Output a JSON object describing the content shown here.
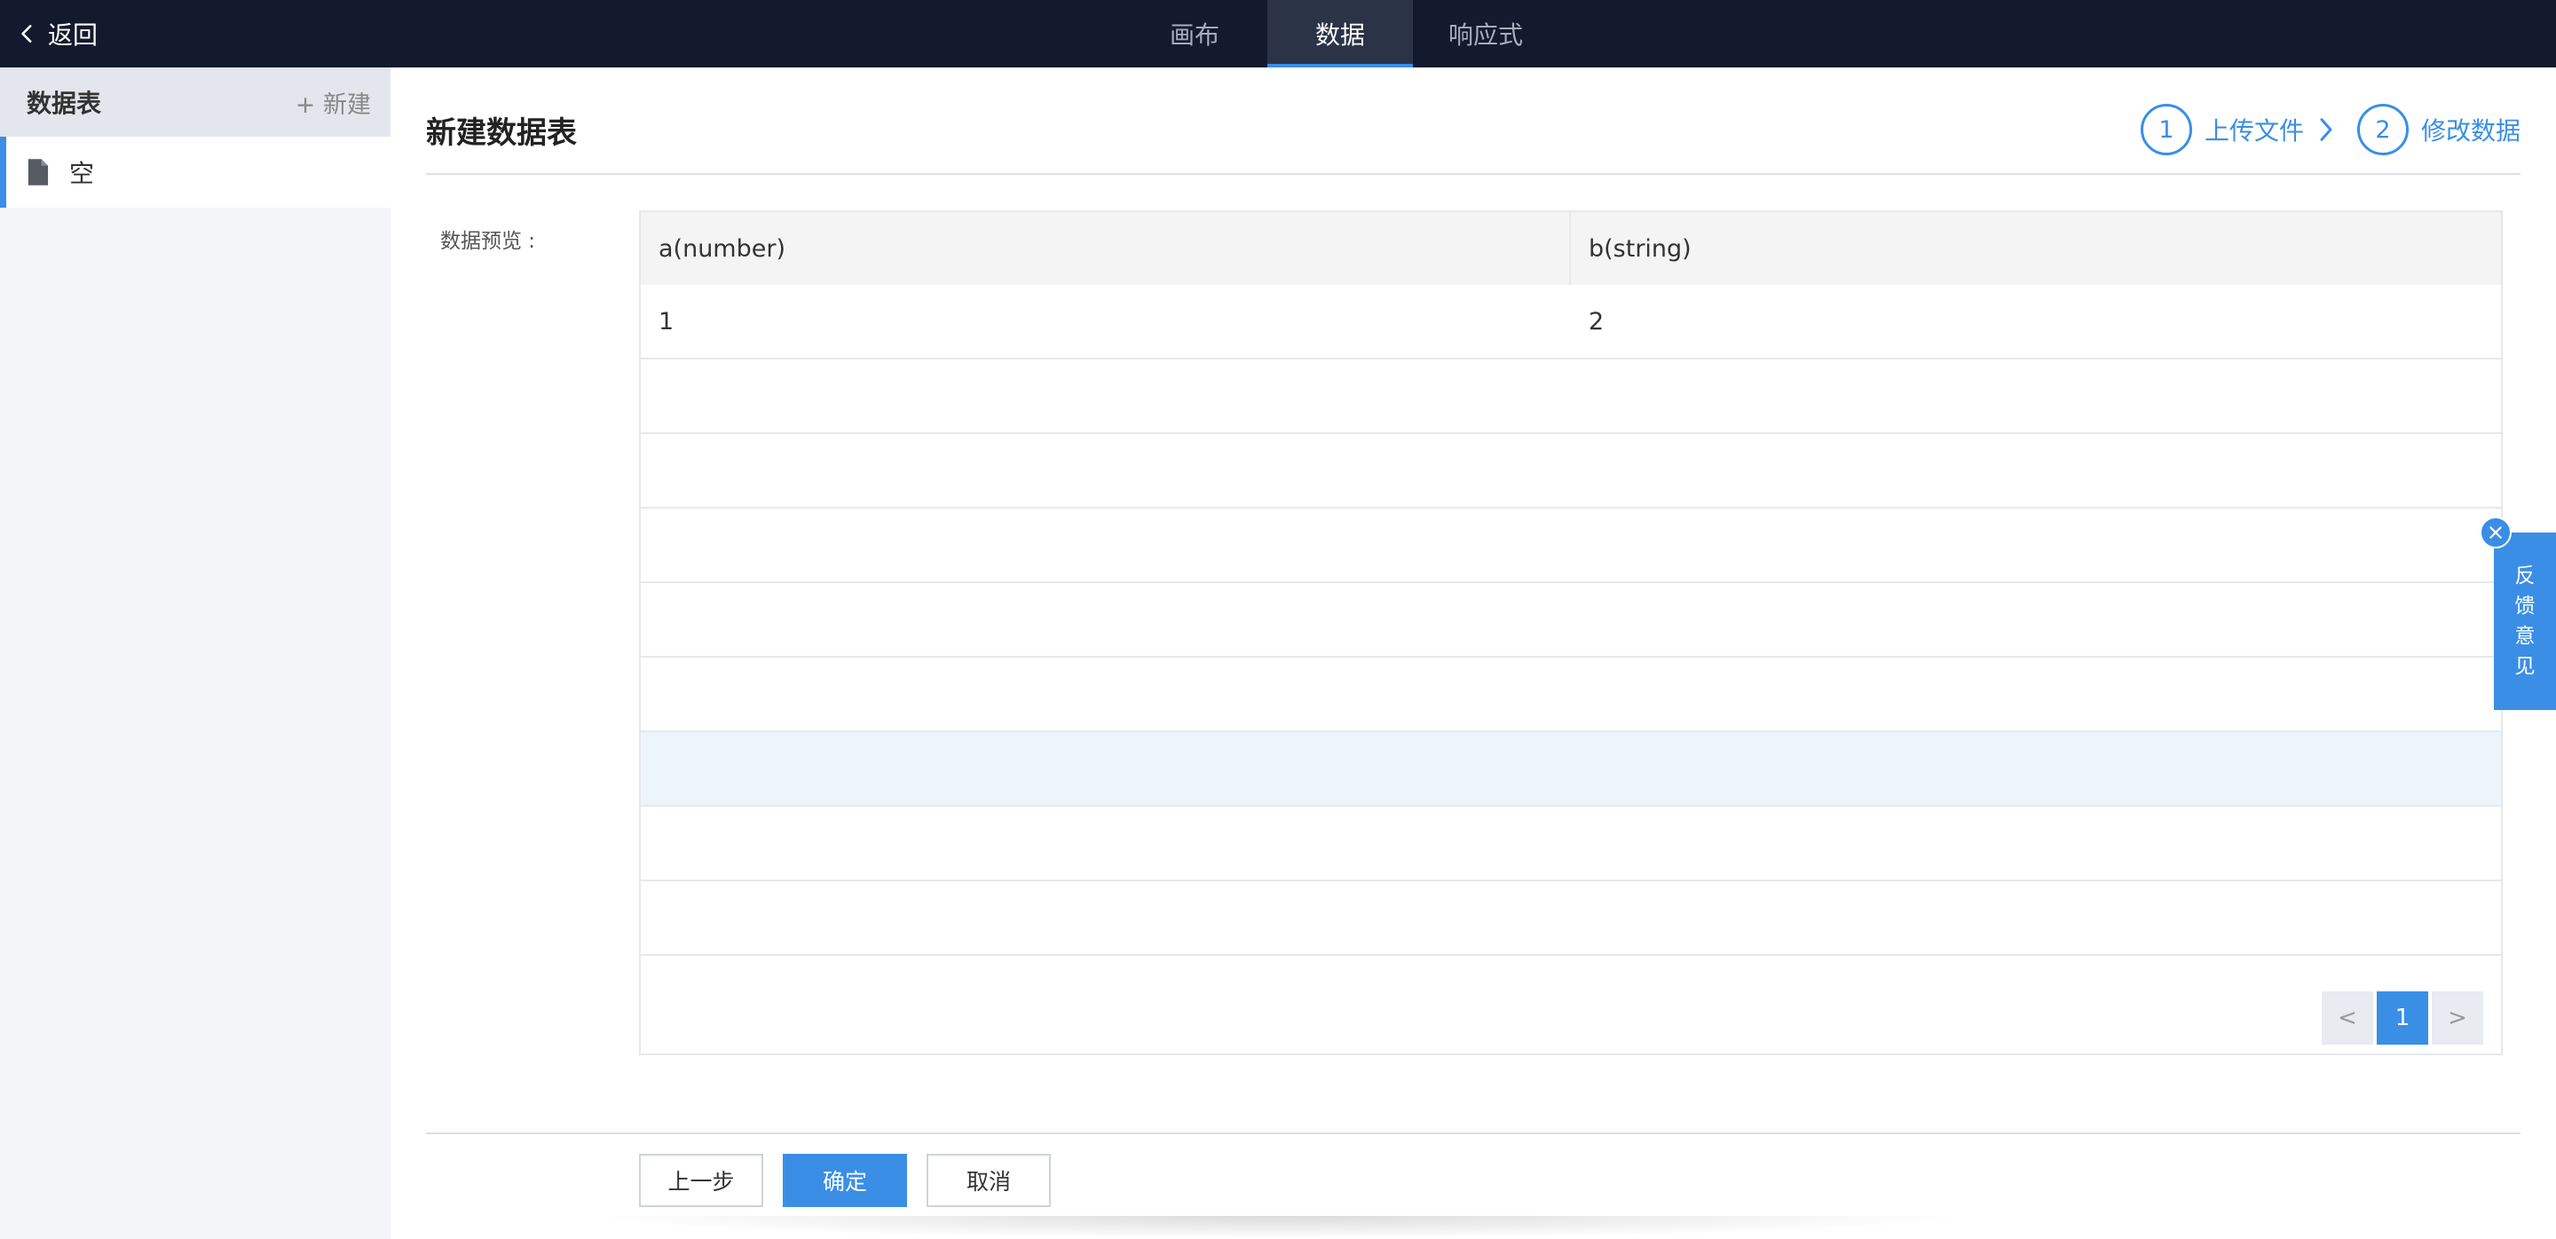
{
  "topbar": {
    "back_label": "返回",
    "tabs": [
      {
        "label": "画布",
        "active": false
      },
      {
        "label": "数据",
        "active": true
      },
      {
        "label": "响应式",
        "active": false
      }
    ]
  },
  "sidebar": {
    "title": "数据表",
    "new_label": "+ 新建",
    "items": [
      {
        "label": "空",
        "icon": "file-icon"
      }
    ]
  },
  "main": {
    "title": "新建数据表",
    "steps": [
      {
        "number": "1",
        "label": "上传文件"
      },
      {
        "number": "2",
        "label": "修改数据"
      }
    ],
    "preview_label": "数据预览 :",
    "table": {
      "columns": [
        "a(number)",
        "b(string)"
      ],
      "rows": [
        [
          "1",
          "2"
        ]
      ]
    },
    "pagination": {
      "prev": "<",
      "current_page": "1",
      "next": ">"
    },
    "actions": {
      "prev_step": "上一步",
      "confirm": "确定",
      "cancel": "取消"
    }
  },
  "feedback": {
    "label_chars": [
      "反",
      "馈",
      "意",
      "见"
    ]
  },
  "colors": {
    "topbar_bg": "#141a2e",
    "accent": "#3a8ee6",
    "sidebar_bg": "#f4f5f8",
    "row_highlight": "#ecf5fc"
  }
}
